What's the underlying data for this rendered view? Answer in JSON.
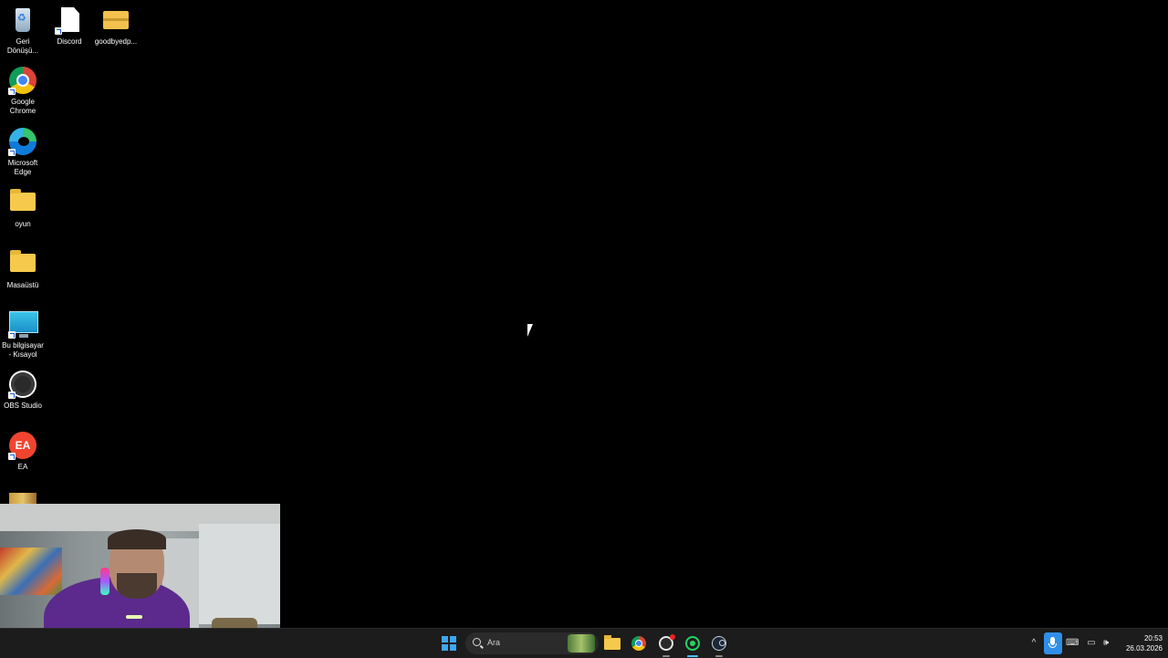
{
  "desktop": {
    "icons": [
      {
        "label": "Geri Dönüşü...",
        "icon": "recycle-bin-icon"
      },
      {
        "label": "Discord",
        "icon": "document-shortcut-icon"
      },
      {
        "label": "goodbyedp...",
        "icon": "zip-folder-icon"
      },
      {
        "label": "Google Chrome",
        "icon": "chrome-icon"
      },
      {
        "label": "Microsoft Edge",
        "icon": "edge-icon"
      },
      {
        "label": "oyun",
        "icon": "folder-icon"
      },
      {
        "label": "Masaüstü",
        "icon": "folder-icon"
      },
      {
        "label": "Bu bilgisayar - Kısayol",
        "icon": "this-pc-icon"
      },
      {
        "label": "OBS Studio",
        "icon": "obs-icon"
      },
      {
        "label": "EA",
        "icon": "ea-icon"
      },
      {
        "label": "",
        "icon": "game-shortcut-icon"
      }
    ],
    "ea_glyph": "EA"
  },
  "taskbar": {
    "search_placeholder": "Ara",
    "pinned": [
      {
        "name": "start",
        "icon": "windows-start-icon"
      },
      {
        "name": "search",
        "icon": "search-icon"
      },
      {
        "name": "file-explorer",
        "icon": "folder-icon"
      },
      {
        "name": "chrome",
        "icon": "chrome-icon"
      },
      {
        "name": "obs",
        "icon": "obs-icon",
        "recording": true
      },
      {
        "name": "whatsapp",
        "icon": "whatsapp-icon",
        "active": true
      },
      {
        "name": "steam",
        "icon": "steam-icon"
      }
    ],
    "tray": {
      "chevron_glyph": "^",
      "keyboard_glyph": "⌨",
      "network_glyph": "▭",
      "volume_glyph": "🕪",
      "time": "20:53",
      "date": "26.03.2026"
    }
  },
  "colors": {
    "accent": "#4cc2ff",
    "taskbar_bg": "#1c1c1c",
    "desktop_bg": "#000000"
  }
}
